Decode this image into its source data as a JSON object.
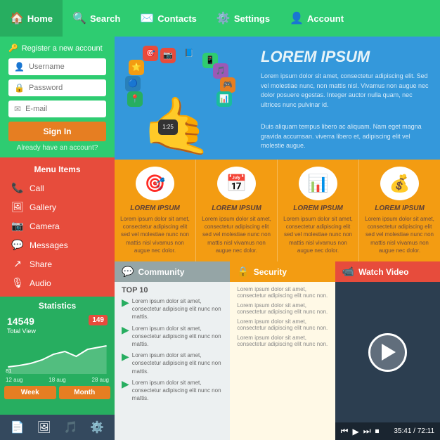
{
  "nav": {
    "items": [
      {
        "label": "Home",
        "icon": "🏠",
        "active": true
      },
      {
        "label": "Search",
        "icon": "🔍",
        "active": false
      },
      {
        "label": "Contacts",
        "icon": "✉️",
        "active": false
      },
      {
        "label": "Settings",
        "icon": "⚙️",
        "active": false
      },
      {
        "label": "Account",
        "icon": "👤",
        "active": false
      }
    ]
  },
  "auth": {
    "title": "Register a new account",
    "username_placeholder": "Username",
    "password_placeholder": "Password",
    "email_placeholder": "E-mail",
    "sign_in_label": "Sign In",
    "link_label": "Already have an account?"
  },
  "menu": {
    "title": "Menu Items",
    "items": [
      {
        "label": "Call",
        "icon": "📞"
      },
      {
        "label": "Gallery",
        "icon": "🖼"
      },
      {
        "label": "Camera",
        "icon": "📷"
      },
      {
        "label": "Messages",
        "icon": "💬"
      },
      {
        "label": "Share",
        "icon": "↗"
      },
      {
        "label": "Audio",
        "icon": "🎙"
      }
    ]
  },
  "stats": {
    "title": "Statistics",
    "total_label": "Total View",
    "total_value": "14549",
    "badge_value": "149",
    "small_value": "81",
    "date1": "12 aug",
    "date2": "18 aug",
    "date3": "28 aug",
    "btn_week": "Week",
    "btn_month": "Month"
  },
  "sidebar_bottom_icons": [
    "📄",
    "🖼",
    "🎵",
    "⚙️"
  ],
  "hero": {
    "title": "LOREM IPSUM",
    "body1": "Lorem ipsum dolor sit amet, consectetur adipiscing elit. Sed vel molestiae nunc, non mattis nisl. Vivamus non augue nec dolor posuere egestas. Integer auctor nulla quam, nec ultrices nunc pulvinar id.",
    "body2": "Duis aliquam tempus libero ac aliquam. Nam eget magna gravida accumsan. viverra libero et, adipiscing elit vel molestie augue."
  },
  "features": [
    {
      "icon": "🎯",
      "title": "LOREM IPSUM",
      "desc": "Lorem ipsum dolor sit amet, consectetur adipiscing elit sed vel molestiae nunc non mattis nisl vivamus non augue nec dolor."
    },
    {
      "icon": "📅",
      "title": "LOREM IPSUM",
      "desc": "Lorem ipsum dolor sit amet, consectetur adipiscing elit sed vel molestiae nunc non mattis nisl vivamus non augue nec dolor."
    },
    {
      "icon": "📊",
      "title": "LOREM IPSUM",
      "desc": "Lorem ipsum dolor sit amet, consectetur adipiscing elit sed vel molestiae nunc non mattis nisl vivamus non augue nec dolor."
    },
    {
      "icon": "💰",
      "title": "LOREM IPSUM",
      "desc": "Lorem ipsum dolor sit amet, consectetur adipiscing elit sed vel molestiae nunc non mattis nisl vivamus non augue nec dolor."
    }
  ],
  "community": {
    "header_icon": "💬",
    "header_title": "Community",
    "top10_label": "TOP 10",
    "items": [
      "Lorem ipsum dolor sit amet, consectetur adipiscing elit nunc non mattis.",
      "Lorem ipsum dolor sit amet, consectetur adipiscing elit nunc non mattis.",
      "Lorem ipsum dolor sit amet, consectetur adipiscing elit nunc non mattis.",
      "Lorem ipsum dolor sit amet, consectetur adipiscing elit nunc non mattis."
    ]
  },
  "security": {
    "header_icon": "🔒",
    "header_title": "Security",
    "items": [
      "Lorem ipsum dolor sit amet, consectetur adipiscing elit nunc non.",
      "Lorem ipsum dolor sit amet, consectetur adipiscing elit nunc non.",
      "Lorem ipsum dolor sit amet, consectetur adipiscing elit nunc non.",
      "Lorem ipsum dolor sit amet, consectetur adipiscing elit nunc non."
    ]
  },
  "watch_video": {
    "header_icon": "📹",
    "header_title": "Watch Video",
    "time": "35:41 / 72:11"
  }
}
